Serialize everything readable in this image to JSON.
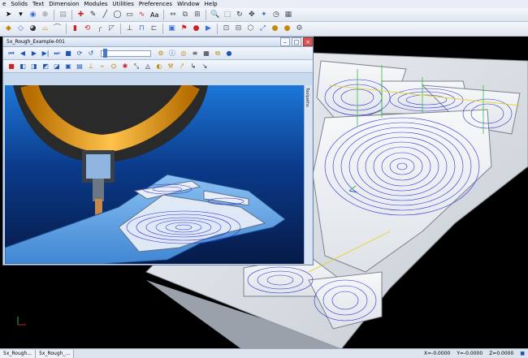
{
  "menubar": {
    "items": [
      "e",
      "Solids",
      "Text",
      "Dimension",
      "Modules",
      "Utilities",
      "Preferences",
      "Window",
      "Help"
    ]
  },
  "toolbar1": {
    "text_style_label": "Aa"
  },
  "sim_window": {
    "title": "5x_Rough_Example-001",
    "minimize": "–",
    "maximize": "□",
    "close": "×",
    "side_tab": "Toolpaths"
  },
  "status": {
    "tabs": [
      "5x_Rough...",
      "5x_Rough_..."
    ],
    "x": "X=-0.0000",
    "y": "Y=-0.0000",
    "z": "Z=0.0000"
  },
  "colors": {
    "toolpath": "#2b2fd6",
    "tool_body": "#f0a81c",
    "stock": "#5aa0e8",
    "part_gray": "#d9dde3"
  },
  "icons": [
    "select-arrow-icon",
    "pen-icon",
    "circle-icon",
    "line-icon",
    "rectangle-icon",
    "zoom-icon",
    "rotate-icon",
    "play-icon",
    "rewind-icon",
    "stop-icon",
    "fast-forward-icon",
    "loop-icon",
    "cube-icon",
    "gear-icon"
  ]
}
